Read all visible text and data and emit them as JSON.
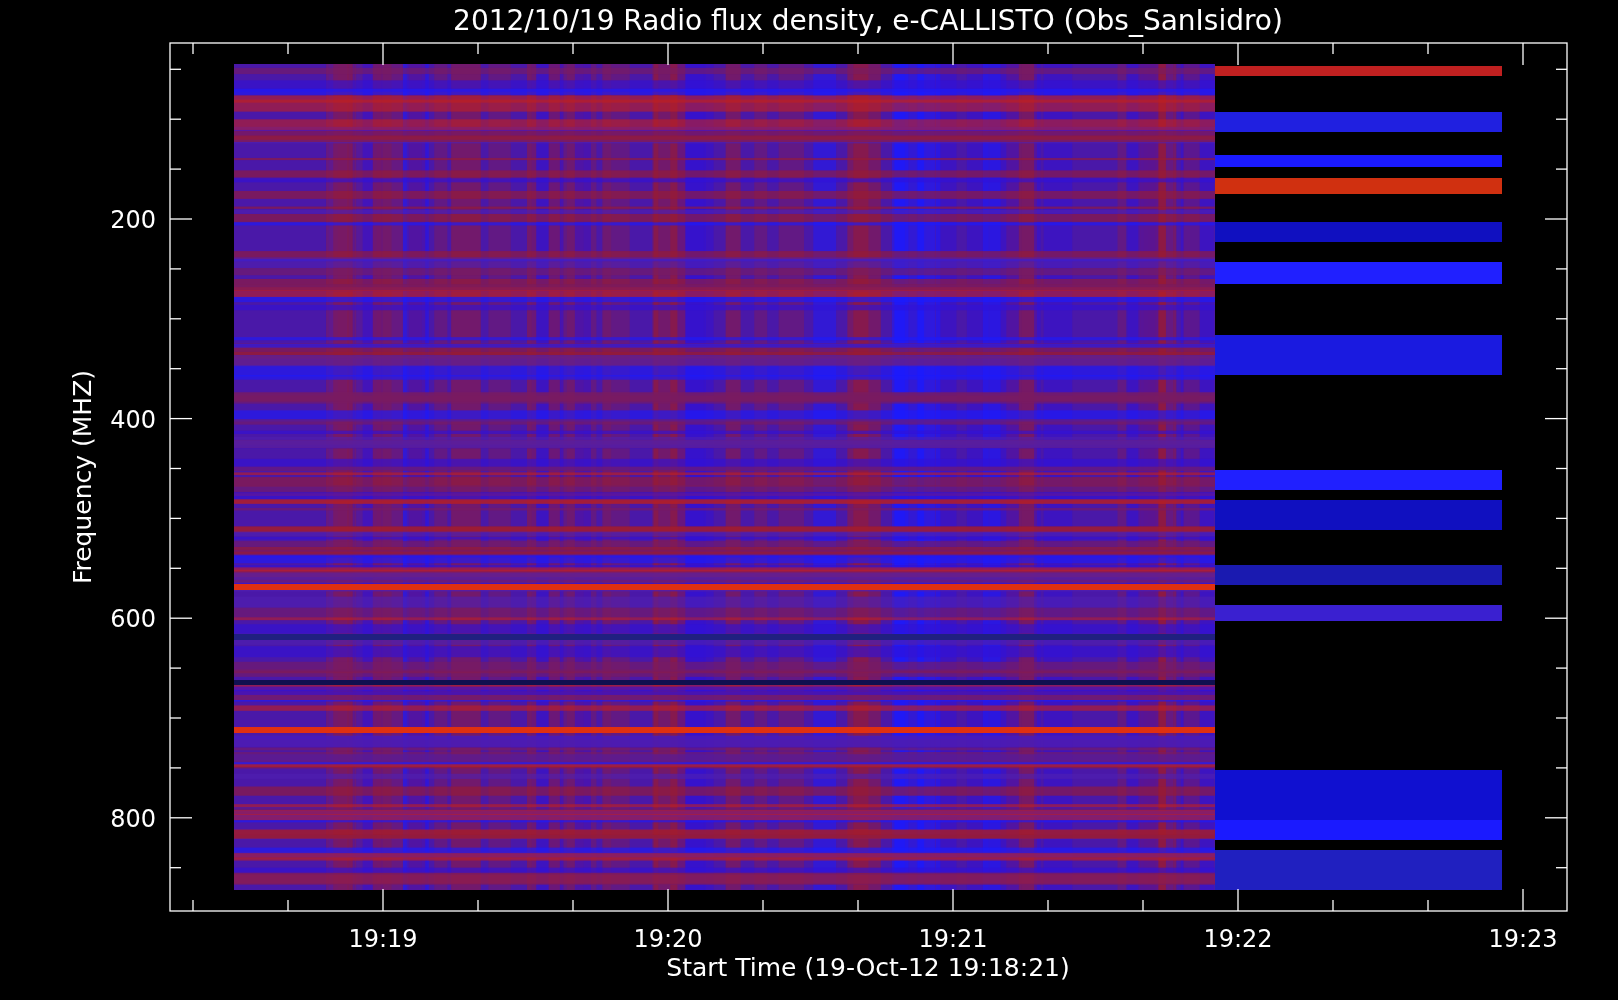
{
  "title": "2012/10/19  Radio flux density, e-CALLISTO (Obs_SanIsidro)",
  "ylabel": "Frequency (MHZ)",
  "xlabel": "Start Time (19-Oct-12 19:18:21)",
  "yticks": [
    "200",
    "400",
    "600",
    "800"
  ],
  "xticks": [
    "19:19",
    "19:20",
    "19:21",
    "19:22",
    "19:23"
  ]
}
